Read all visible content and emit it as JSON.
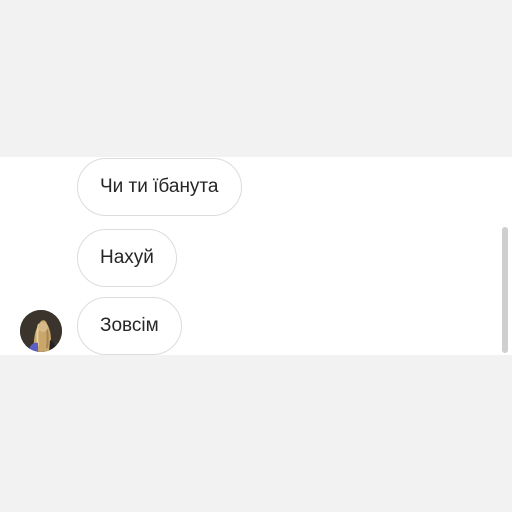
{
  "conversation": {
    "messages": [
      {
        "text": "Чи ти їбанута"
      },
      {
        "text": "Нахуй"
      },
      {
        "text": "Зовсім"
      }
    ],
    "sender_avatar": {
      "icon": "user-avatar"
    }
  },
  "colors": {
    "background": "#f2f2f2",
    "panel": "#ffffff",
    "bubble_border": "#dcdcdc",
    "text": "#262626"
  }
}
